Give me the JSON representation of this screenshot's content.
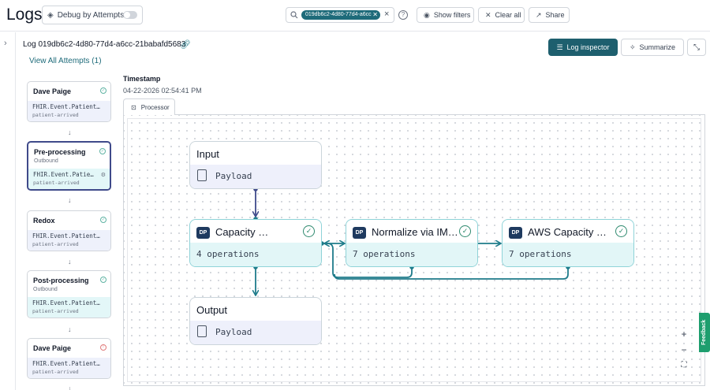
{
  "header": {
    "title": "Logs",
    "debug_label": "Debug by Attempts",
    "search_chip": "019db6c2-4d80-77d4-a6cc",
    "show_filters": "Show filters",
    "clear_all": "Clear all",
    "share": "Share"
  },
  "log": {
    "title": "Log 019db6c2-4d80-77d4-a6cc-21babafd5683",
    "view_attempts": "View All Attempts (1)",
    "inspector_label": "Log inspector",
    "summarize_label": "Summarize"
  },
  "steps": [
    {
      "name": "Dave Paige",
      "sub": "",
      "event_type": "FHIR.Event.Patient…",
      "event_name": "patient-arrived",
      "status": "ok"
    },
    {
      "name": "Pre-processing",
      "sub": "Outbound",
      "event_type": "FHIR.Event.Patie…",
      "event_name": "patient-arrived",
      "status": "ok"
    },
    {
      "name": "Redox",
      "sub": "",
      "event_type": "FHIR.Event.Patient…",
      "event_name": "patient-arrived",
      "status": "ok"
    },
    {
      "name": "Post-processing",
      "sub": "Outbound",
      "event_type": "FHIR.Event.Patient…",
      "event_name": "patient-arrived",
      "status": "ok"
    },
    {
      "name": "Dave Paige",
      "sub": "",
      "event_type": "FHIR.Event.Patient…",
      "event_name": "patient-arrived",
      "status": "error"
    }
  ],
  "timestamp": {
    "label": "Timestamp",
    "value": "04-22-2026 02:54:41 PM"
  },
  "tab": {
    "label": "Processor"
  },
  "nodes": {
    "input": {
      "title": "Input",
      "body": "Payload"
    },
    "capacity": {
      "badge": "DP",
      "title": "Capacity …",
      "body": "4 operations"
    },
    "normalize": {
      "badge": "DP",
      "title": "Normalize via IM…",
      "body": "7 operations"
    },
    "aws": {
      "badge": "DP",
      "title": "AWS Capacity …",
      "body": "7 operations"
    },
    "output": {
      "title": "Output",
      "body": "Payload"
    }
  },
  "zoom": {
    "plus": "+",
    "minus": "−"
  },
  "feedback": "Feedback",
  "colors": {
    "accent": "#1e5f6e",
    "edge": "#1e7b8a",
    "input_edge": "#3f4a8a",
    "feedback": "#1e9e6e"
  }
}
